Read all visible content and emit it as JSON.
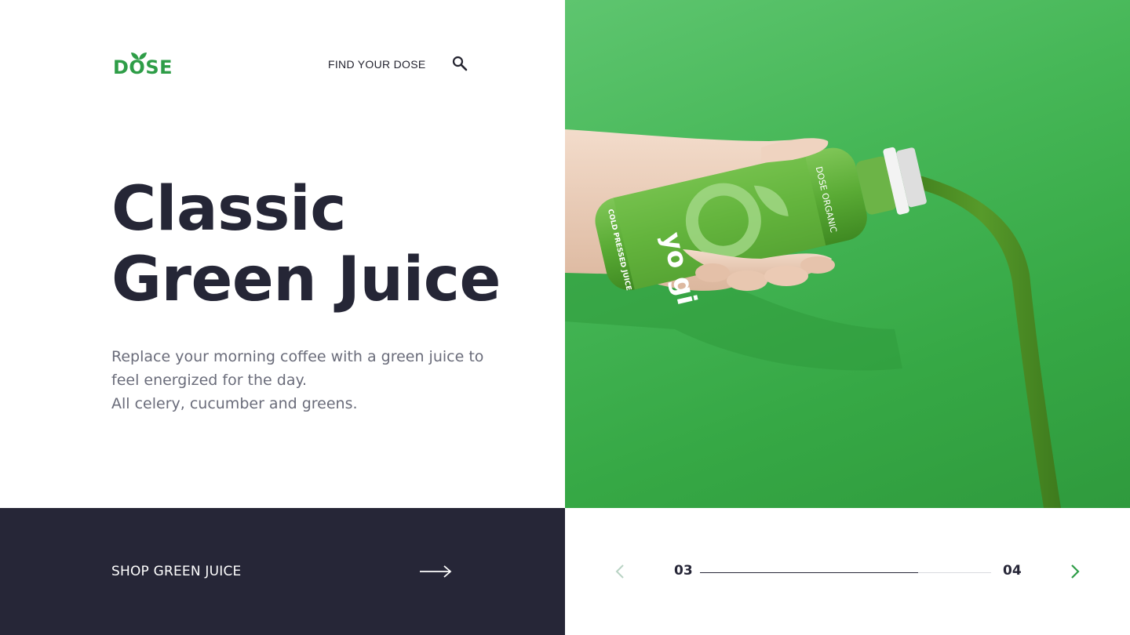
{
  "brand": {
    "name": "DOSE",
    "color": "#2e9d47"
  },
  "nav": {
    "find_label": "FIND YOUR DOSE",
    "search_icon": "search-icon"
  },
  "hero": {
    "title_line1": "Classic",
    "title_line2": "Green Juice",
    "desc_line1": "Replace your morning coffee with a green juice to",
    "desc_line2": "feel energized for the day.",
    "desc_line3": "All celery, cucumber and greens.",
    "image_bg": "#46b757"
  },
  "shop": {
    "label": "SHOP GREEN JUICE",
    "arrow_icon": "arrow-right-icon",
    "bg": "#262637"
  },
  "pager": {
    "current": "03",
    "total": "04",
    "progress": 0.75,
    "prev_icon": "chevron-left-icon",
    "next_icon": "chevron-right-icon",
    "prev_color": "#b9d3c4",
    "next_color": "#2e9d47"
  },
  "product": {
    "label_brand": "DOSE ORGANIC",
    "label_tagline": "COLD PRESSED JUICE",
    "label_word": "yo gi"
  }
}
